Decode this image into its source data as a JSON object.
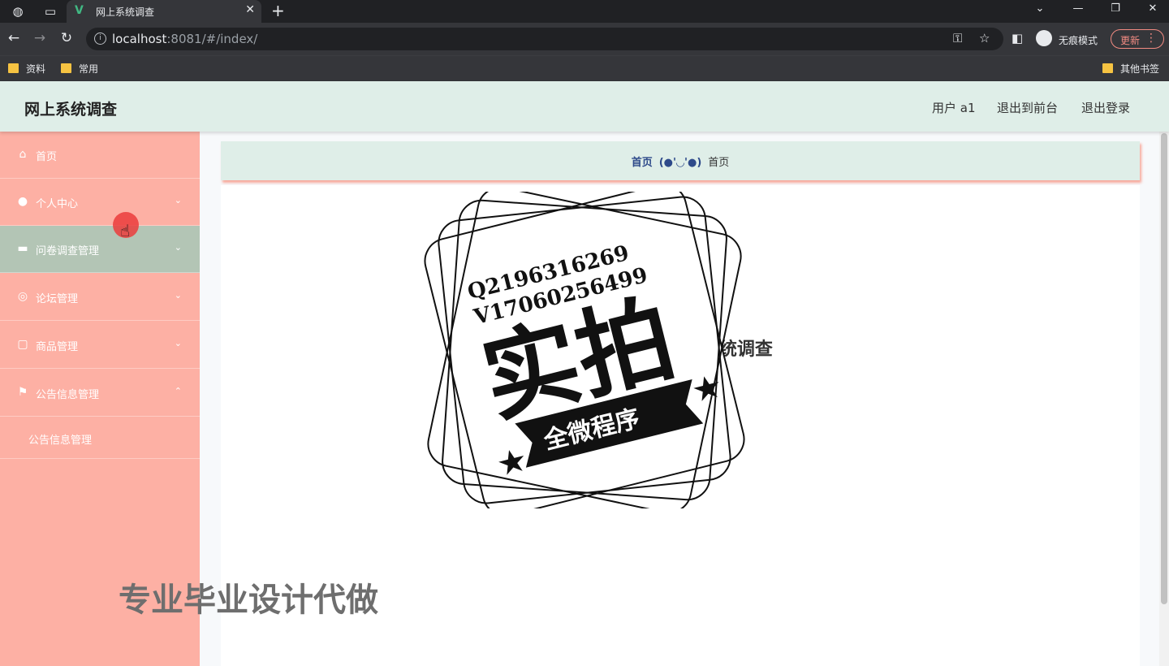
{
  "browser": {
    "tab_title": "网上系统调查",
    "url_host": "localhost",
    "url_rest": ":8081/#/index/",
    "incognito_label": "无痕模式",
    "update_label": "更新",
    "bookmarks": [
      "资料",
      "常用"
    ],
    "other_bookmarks": "其他书签"
  },
  "app": {
    "title": "网上系统调查",
    "header_links": [
      "用户 a1",
      "退出到前台",
      "退出登录"
    ]
  },
  "sidebar": {
    "items": [
      {
        "label": "首页",
        "icon": "home-icon"
      },
      {
        "label": "个人中心",
        "icon": "user-icon"
      },
      {
        "label": "问卷调查管理",
        "icon": "ticket-icon"
      },
      {
        "label": "论坛管理",
        "icon": "forum-icon"
      },
      {
        "label": "商品管理",
        "icon": "product-icon"
      },
      {
        "label": "公告信息管理",
        "icon": "flag-icon"
      }
    ],
    "submenu": [
      "公告信息管理"
    ]
  },
  "breadcrumb": {
    "home": "首页",
    "separator": "(●'◡'●)",
    "current": "首页"
  },
  "main": {
    "welcome": "欢迎使用 网上系统调查"
  },
  "overlay": {
    "stamp_line1": "Q2196316269",
    "stamp_line2": "V17060256499",
    "stamp_big": "实拍",
    "stamp_banner": "全微程序",
    "bottom_text": "专业毕业设计代做"
  },
  "colors": {
    "header_bg": "#dfeee8",
    "sidebar_bg": "#fdb0a4",
    "sidebar_active_bg": "#b3c5b5",
    "breadcrumb_home": "#2e4a8a"
  }
}
